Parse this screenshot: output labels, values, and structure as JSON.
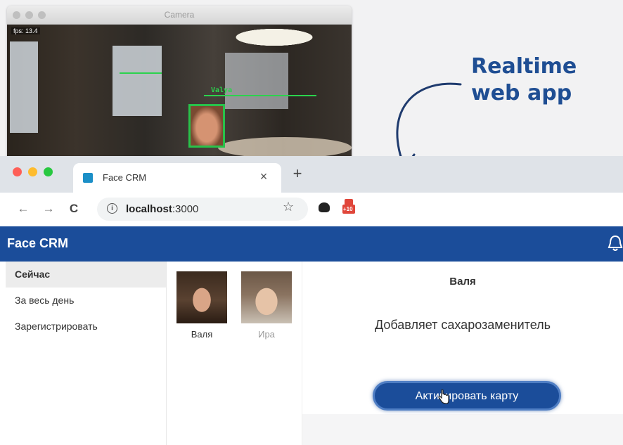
{
  "camera": {
    "title": "Camera",
    "fps": "fps: 13.4",
    "label": "Valya"
  },
  "annotation": {
    "line1": "Realtime",
    "line2": "web app"
  },
  "browser": {
    "tab_title": "Face CRM",
    "tab_close": "×",
    "new_tab": "+",
    "nav": {
      "back": "←",
      "forward": "→",
      "reload": "C"
    },
    "url_host": "localhost",
    "url_port": ":3000",
    "info": "i",
    "star": "☆",
    "ext_badge": "+10"
  },
  "app": {
    "title": "Face CRM",
    "sidebar": [
      {
        "label": "Сейчас"
      },
      {
        "label": "За весь день"
      },
      {
        "label": "Зарегистрировать"
      }
    ],
    "people": [
      {
        "name": "Валя"
      },
      {
        "name": "Ира"
      }
    ],
    "detail": {
      "name": "Валя",
      "text": "Добавляет сахарозаменитель",
      "button": "Активировать карту"
    }
  },
  "colors": {
    "primary": "#1b4d9a",
    "annotation": "#1f4e93",
    "detection": "#28c24a"
  }
}
